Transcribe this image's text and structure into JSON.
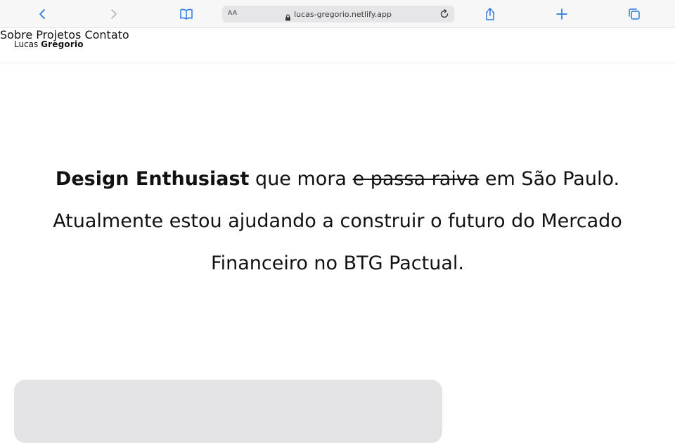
{
  "browser": {
    "aa_label": "AA",
    "url": "lucas-gregorio.netlify.app",
    "accent_color": "#2a7de1",
    "icons": [
      "back-icon",
      "forward-icon",
      "book-icon",
      "lock-icon",
      "reload-icon",
      "share-icon",
      "plus-icon",
      "tabs-icon"
    ]
  },
  "site": {
    "logo_first": "Lucas",
    "logo_last": "Gregorio",
    "nav": [
      {
        "label": "Sobre"
      },
      {
        "label": "Projetos"
      },
      {
        "label": "Contato"
      }
    ]
  },
  "hero": {
    "bold": "Design Enthusiast",
    "text1": " que mora ",
    "struck": "e passa raiva",
    "text2": " em São Paulo.",
    "line2": "Atualmente estou ajudando a construir o futuro do Mercado",
    "line3": "Financeiro no BTG Pactual."
  }
}
